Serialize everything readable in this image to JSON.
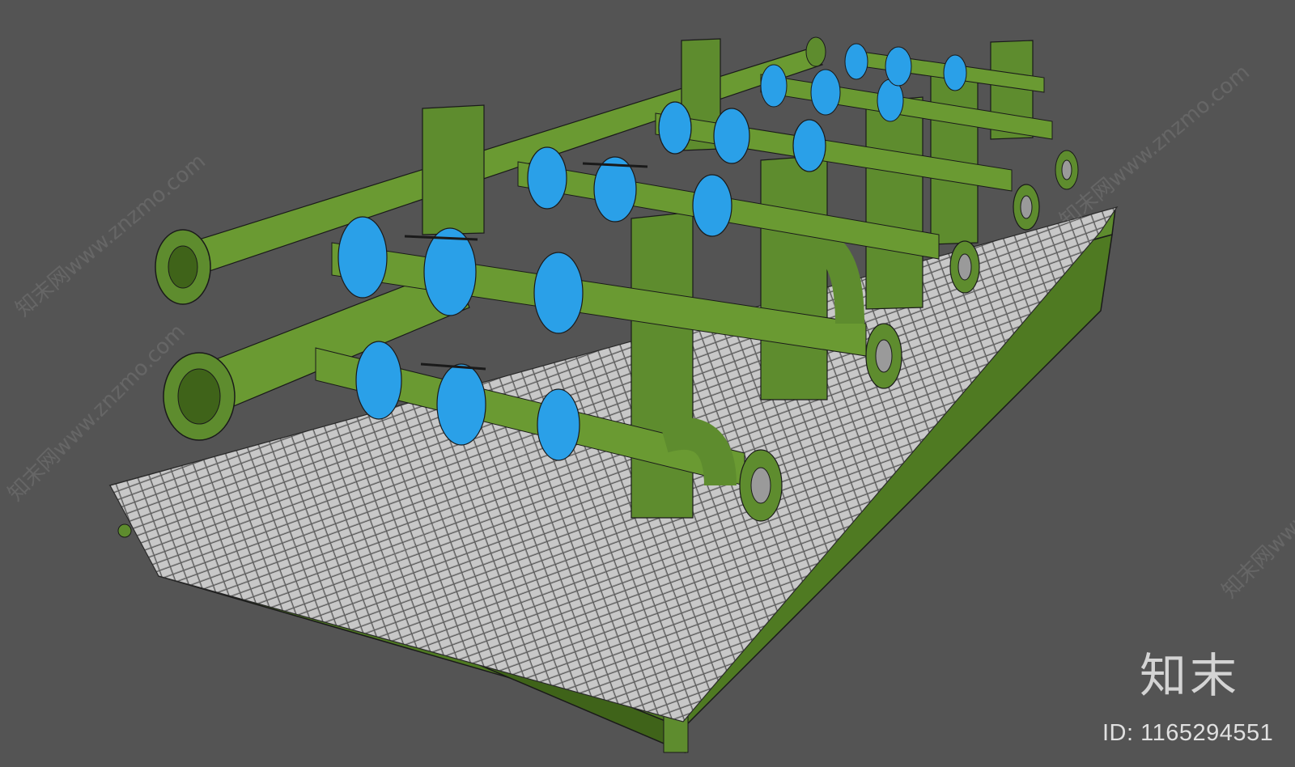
{
  "viewport": {
    "background": "#545454"
  },
  "scene": {
    "subject": "3d-pipe-skid",
    "colors": {
      "pipe_green": "#5e8c2e",
      "pipe_green_dark": "#3f6319",
      "valve_blue": "#2aa0e8",
      "valve_blue_dark": "#1470b4",
      "grating": "#b9b9b9",
      "edge_line": "#1a1a1a"
    }
  },
  "watermarks": {
    "text": "知末网www.znzmo.com"
  },
  "branding": {
    "logo_text": "知末",
    "id_text": "ID: 1165294551"
  }
}
